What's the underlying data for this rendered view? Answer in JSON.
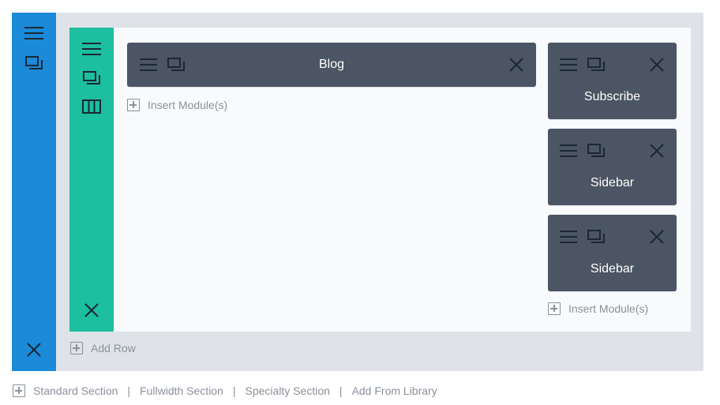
{
  "colors": {
    "section": "#1a8ad9",
    "row": "#1cbfa0",
    "module": "#4b5563",
    "canvas": "#dfe3e8",
    "row_body": "#f9fafc",
    "muted_text": "#8a919a"
  },
  "section": {
    "icons": [
      "menu-icon",
      "duplicate-icon",
      "close-icon"
    ],
    "add_row_label": "Add Row",
    "row": {
      "icons": [
        "menu-icon",
        "duplicate-icon",
        "columns-icon",
        "close-icon"
      ],
      "left_column": {
        "modules": [
          {
            "label": "Blog",
            "icons": [
              "menu-icon",
              "duplicate-icon",
              "close-icon"
            ]
          }
        ],
        "insert_label": "Insert Module(s)"
      },
      "right_column": {
        "modules": [
          {
            "label": "Subscribe",
            "icons": [
              "menu-icon",
              "duplicate-icon",
              "close-icon"
            ]
          },
          {
            "label": "Sidebar",
            "icons": [
              "menu-icon",
              "duplicate-icon",
              "close-icon"
            ]
          },
          {
            "label": "Sidebar",
            "icons": [
              "menu-icon",
              "duplicate-icon",
              "close-icon"
            ]
          }
        ],
        "insert_label": "Insert Module(s)"
      }
    }
  },
  "bottom_bar": {
    "links": [
      "Standard Section",
      "Fullwidth Section",
      "Specialty Section",
      "Add From Library"
    ],
    "separator": "|"
  }
}
